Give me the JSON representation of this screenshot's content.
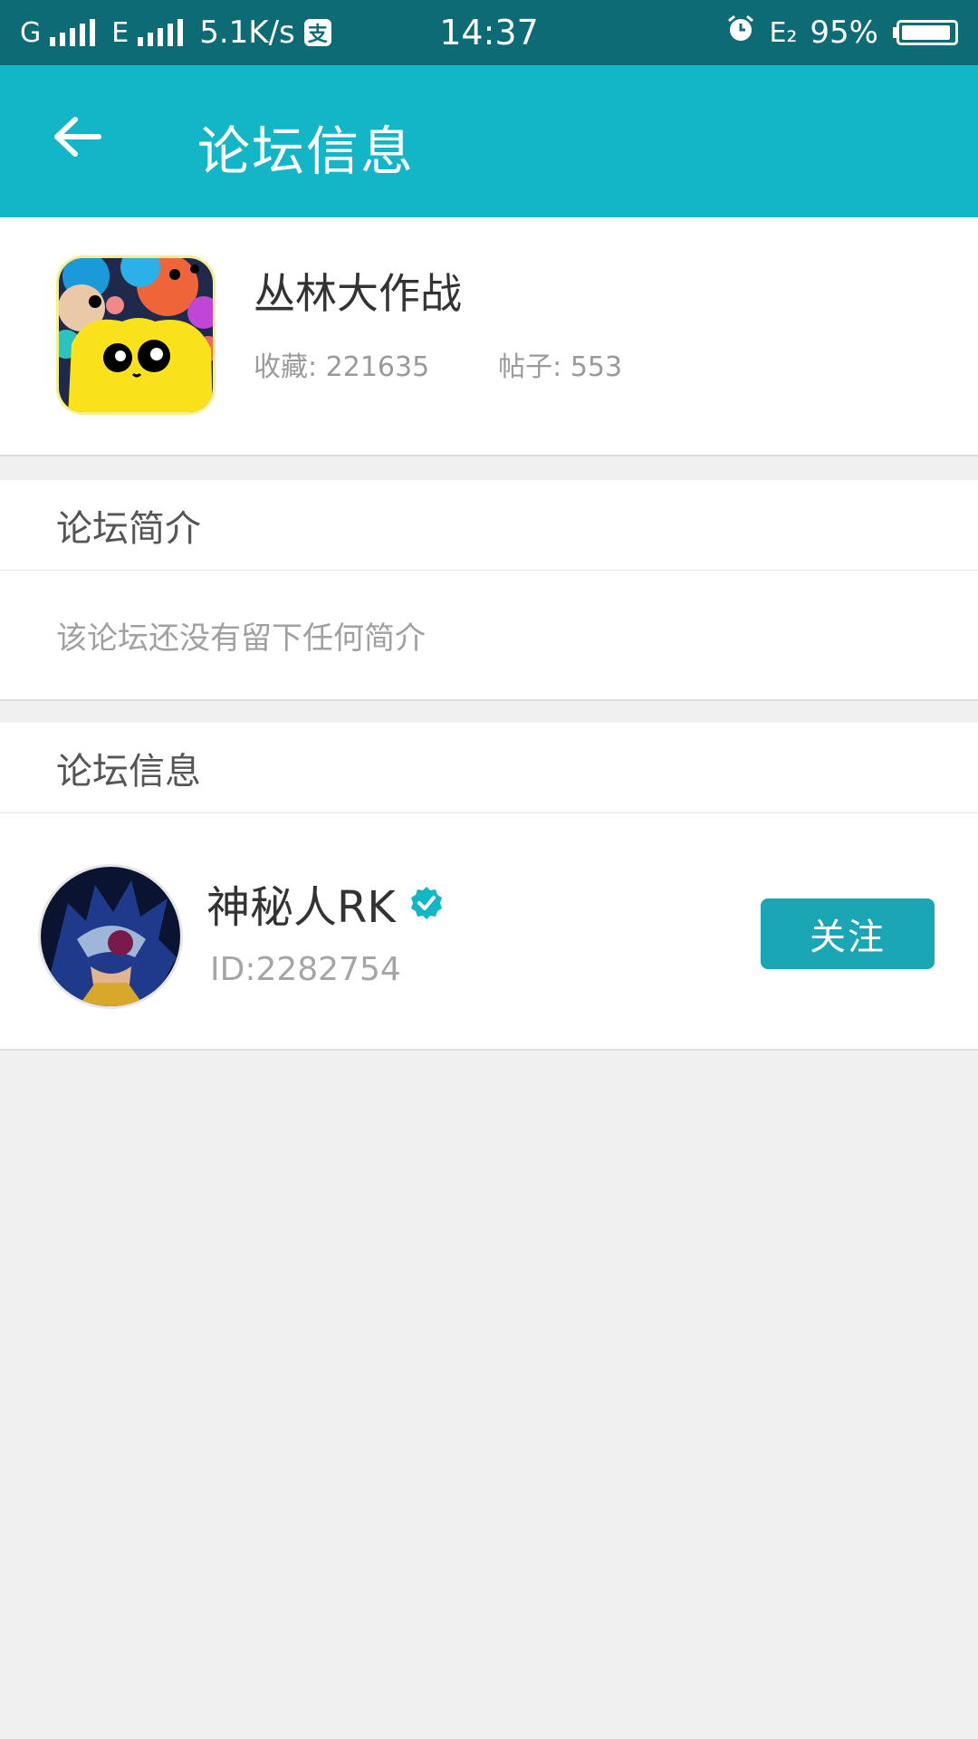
{
  "status_bar": {
    "carrier1": "G",
    "carrier2": "E",
    "speed": "5.1K/s",
    "pay_icon_text": "支",
    "time": "14:37",
    "network_badge": "E₂",
    "battery": "95%",
    "battery_level": 0.95
  },
  "app_bar": {
    "title": "论坛信息",
    "back_icon": "arrow-left-icon"
  },
  "forum": {
    "name": "丛林大作战",
    "favorites": "收藏: 221635",
    "posts": "帖子: 553"
  },
  "intro": {
    "header": "论坛简介",
    "text": "该论坛还没有留下任何简介"
  },
  "info": {
    "header": "论坛信息",
    "user": {
      "name": "神秘人RK",
      "id": "ID:2282754",
      "follow_label": "关注"
    }
  },
  "colors": {
    "status_bar": "#0c6b74",
    "app_bar": "#13b6c6",
    "follow_button": "#1aa6b4",
    "verified_badge": "#13b6c6",
    "background": "#f0f0f0"
  }
}
